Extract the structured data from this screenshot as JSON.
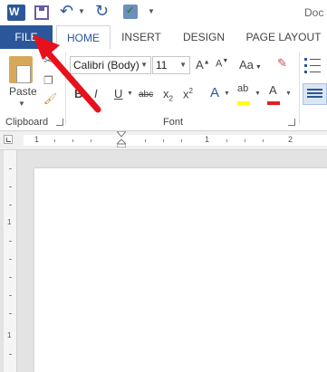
{
  "window": {
    "title_fragment": "Doc"
  },
  "tabs": {
    "file": "FILE",
    "home": "HOME",
    "insert": "INSERT",
    "design": "DESIGN",
    "page_layout": "PAGE LAYOUT"
  },
  "clipboard": {
    "paste_label": "Paste",
    "group_label": "Clipboard"
  },
  "font": {
    "font_name": "Calibri (Body)",
    "font_size": "11",
    "grow": "A",
    "shrink": "A",
    "change_case": "Aa",
    "bold": "B",
    "italic": "I",
    "underline": "U",
    "strikethrough": "abc",
    "subscript": "x",
    "superscript": "x",
    "text_effects": "A",
    "highlight": "ab",
    "font_color": "A",
    "group_label": "Font"
  },
  "ruler": {
    "marks": [
      "1",
      "1",
      "2"
    ]
  },
  "vruler": {
    "marks": [
      "1",
      "1"
    ]
  },
  "colors": {
    "accent": "#2b579a",
    "arrow": "#e8111b",
    "highlight": "#ffff00",
    "font_color": "#e51c23"
  },
  "icons": {
    "app": "word-logo-icon",
    "save": "save-icon",
    "undo": "undo-icon",
    "redo": "redo-icon",
    "customize": "checkmark-shield-icon"
  }
}
